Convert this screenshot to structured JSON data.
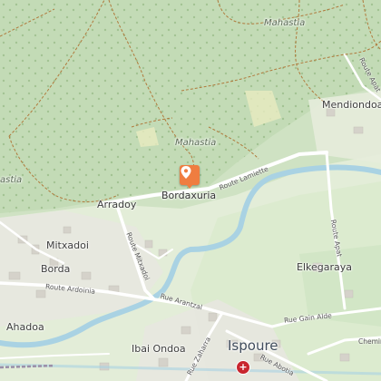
{
  "map": {
    "places": {
      "mahastia_top": "Mahastia",
      "mahastia_mid": "Mahastia",
      "mahastia_left": "astia",
      "mendiondoa": "Mendiondoa",
      "arradoy": "Arradoy",
      "bordaxuria": "Bordaxuria",
      "mitxadoi": "Mitxadoi",
      "borda": "Borda",
      "ahadoa": "Ahadoa",
      "elkegaraya": "Elkegaraya",
      "ibai_ondoa": "Ibai Ondoa",
      "ispoure": "Ispoure"
    },
    "roads": {
      "route_lamiette": "Route Lamiette",
      "route_mitxadoi": "Route Mitxadoi",
      "route_ardoinia": "Route Ardoinia",
      "rue_arantzal": "Rue Arantzal",
      "route_apat_top": "Route Apat",
      "route_apat_right": "Route Apat",
      "rue_gain_alde": "Rue Gain Alde",
      "rue_zaharra": "Rue Zaharra",
      "rue_abotia": "Rue Abotia",
      "chemin": "Chemin"
    },
    "marker": {
      "icon": "location-pin-icon",
      "color": "#ef7d40"
    },
    "poi": {
      "icon": "pharmacy-cross-icon",
      "symbol": "+"
    },
    "colors": {
      "forest": "#c9dec0",
      "meadow": "#e4eedb",
      "river": "#a9d2e3",
      "road": "#ffffff",
      "track": "#b07a3c"
    }
  }
}
